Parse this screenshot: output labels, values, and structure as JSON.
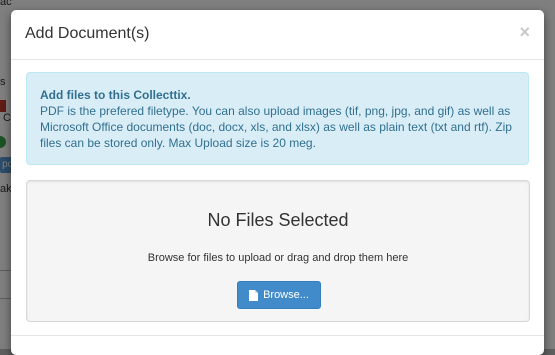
{
  "background": {
    "fragments": [
      "ac",
      "s",
      "C",
      "pdf",
      "ak"
    ]
  },
  "modal": {
    "title": "Add Document(s)",
    "close_symbol": "×"
  },
  "info": {
    "title": "Add files to this Collecttix.",
    "body": "PDF is the prefered filetype. You can also upload images (tif, png, jpg, and gif) as well as Microsoft Office documents (doc, docx, xls, and xlsx) as well as plain text (txt and rtf). Zip files can be stored only. Max Upload size is 20 meg."
  },
  "dropzone": {
    "title": "No Files Selected",
    "hint": "Browse for files to upload or drag and drop them here",
    "browse_label": "Browse...",
    "browse_icon": "file-icon"
  },
  "colors": {
    "primary": "#428bca",
    "alert_bg": "#d9edf7",
    "alert_text": "#31708f"
  }
}
